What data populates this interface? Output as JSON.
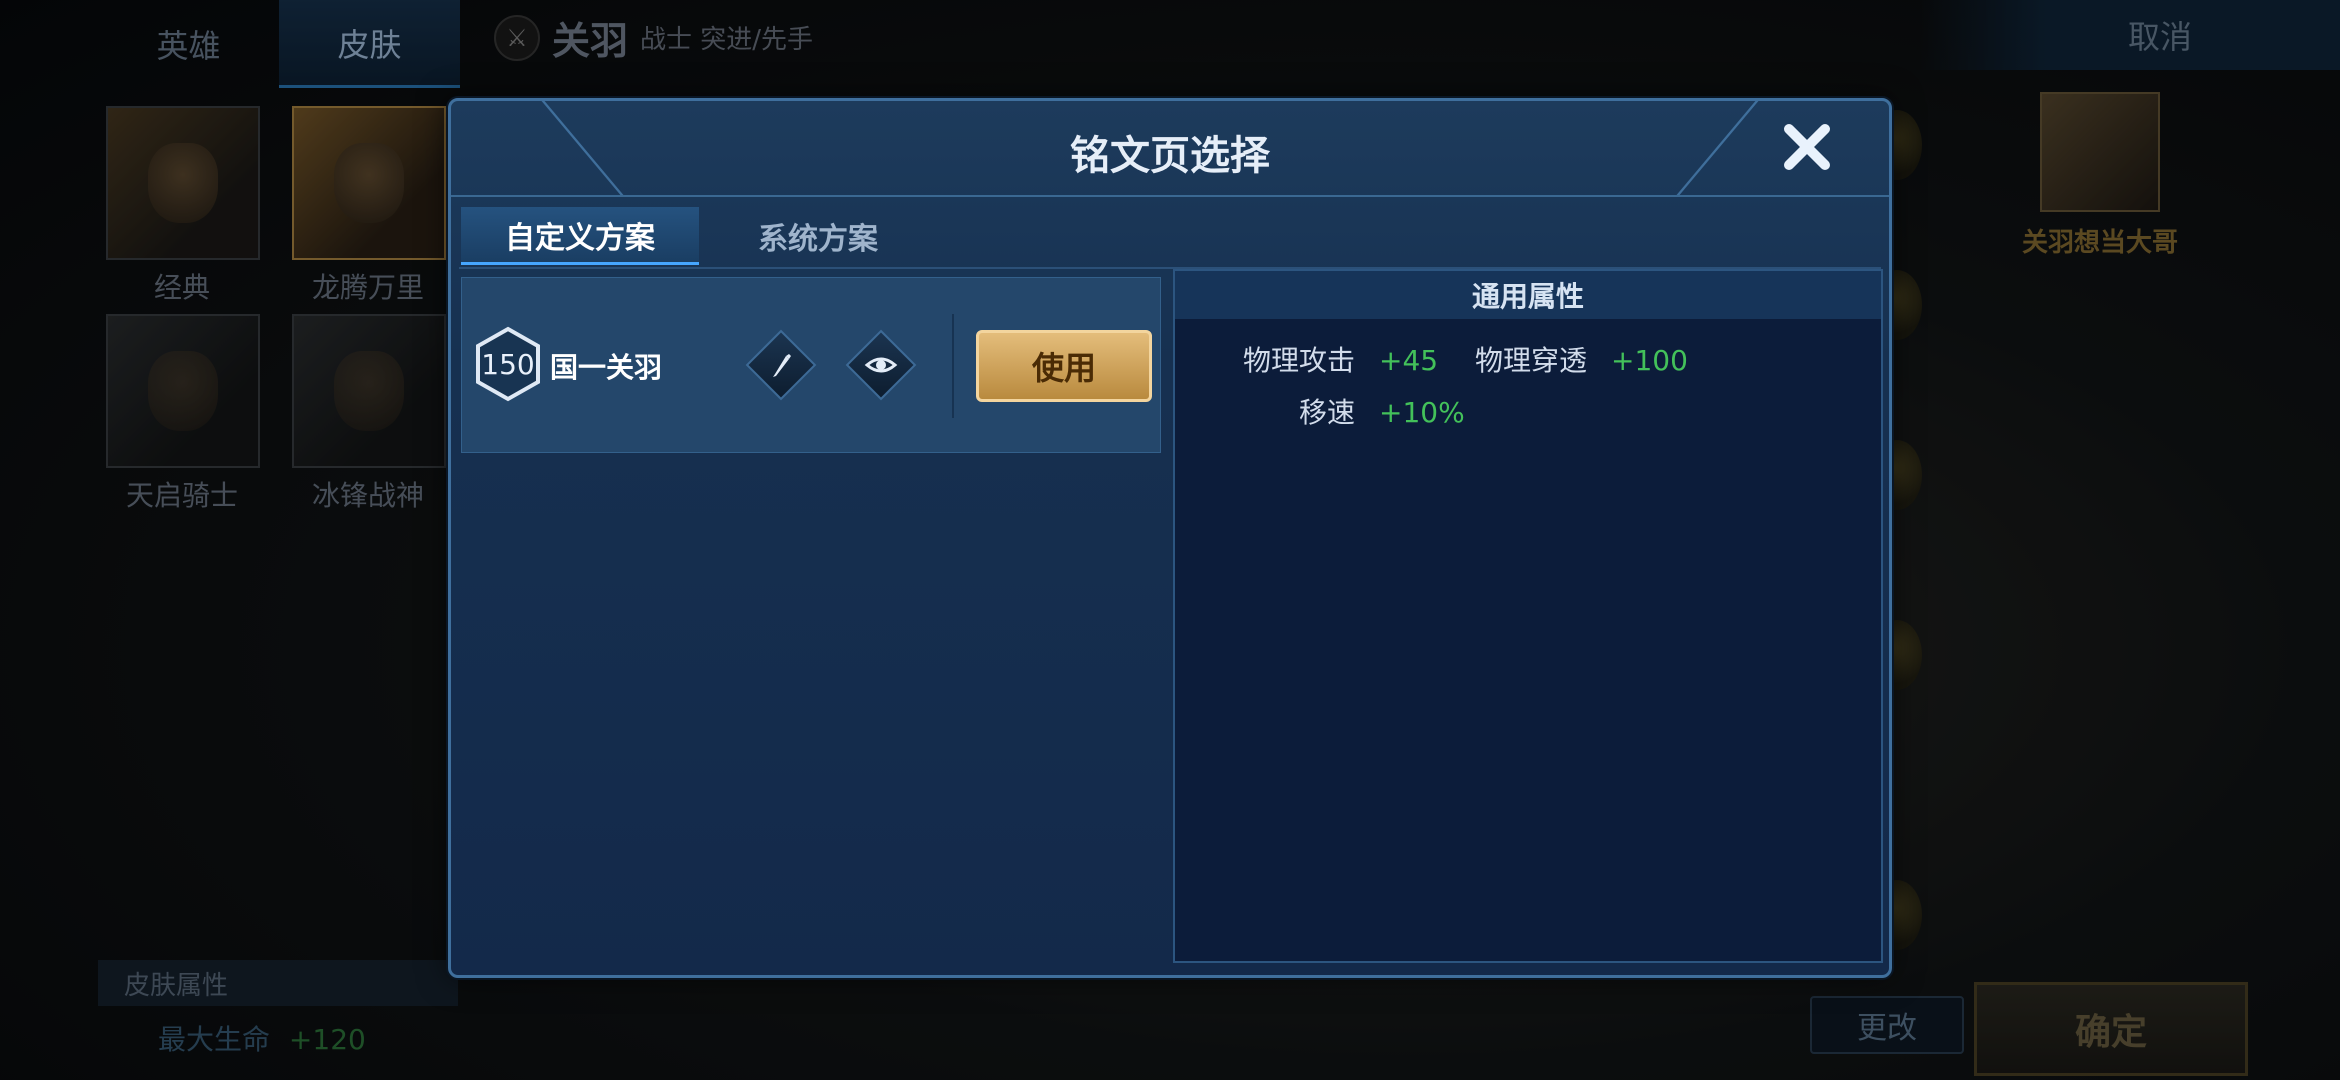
{
  "background": {
    "left_tabs": [
      "英雄",
      "皮肤"
    ],
    "skins": [
      "经典",
      "龙腾万里",
      "天启骑士",
      "冰锋战神"
    ],
    "hero": {
      "badge_icon": "sword-icon",
      "name": "关羽",
      "role": "战士 突进/先手"
    },
    "cancel_label": "取消",
    "player_name": "关羽想当大哥",
    "skin_attr_title": "皮肤属性",
    "skin_attr": {
      "key": "最大生命",
      "value": "+120"
    },
    "change_label": "更改",
    "confirm_label": "确定"
  },
  "modal": {
    "title": "铭文页选择",
    "close_icon": "close-icon",
    "tabs": [
      {
        "label": "自定义方案",
        "active": true
      },
      {
        "label": "系统方案",
        "active": false
      }
    ],
    "page": {
      "level": "150",
      "name": "国一关羽",
      "edit_icon": "pencil-icon",
      "preview_icon": "eye-icon",
      "use_label": "使用"
    },
    "attributes": {
      "title": "通用属性",
      "items": [
        {
          "key": "物理攻击",
          "value": "+45"
        },
        {
          "key": "物理穿透",
          "value": "+100"
        },
        {
          "key": "移速",
          "value": "+10%"
        }
      ]
    }
  },
  "colors": {
    "accent_gold": "#e4bd7b",
    "stat_green": "#43c15a",
    "panel_blue": "#163050"
  }
}
